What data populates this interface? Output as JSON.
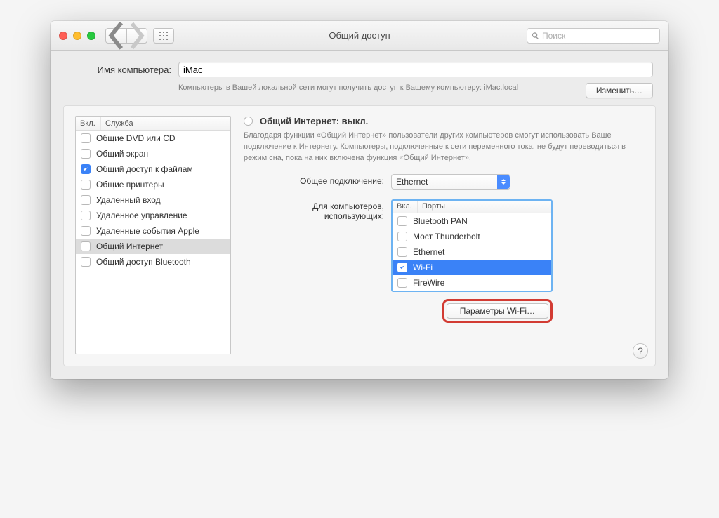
{
  "window": {
    "title": "Общий доступ",
    "search_placeholder": "Поиск"
  },
  "computer": {
    "label": "Имя компьютера:",
    "value": "iMac",
    "desc": "Компьютеры в Вашей локальной сети могут получить доступ к Вашему компьютеру: iMac.local",
    "edit_btn": "Изменить…"
  },
  "services": {
    "col_enabled": "Вкл.",
    "col_service": "Служба",
    "items": [
      {
        "label": "Общие DVD или CD",
        "checked": false
      },
      {
        "label": "Общий экран",
        "checked": false
      },
      {
        "label": "Общий доступ к файлам",
        "checked": true
      },
      {
        "label": "Общие принтеры",
        "checked": false
      },
      {
        "label": "Удаленный вход",
        "checked": false
      },
      {
        "label": "Удаленное управление",
        "checked": false
      },
      {
        "label": "Удаленные события Apple",
        "checked": false
      },
      {
        "label": "Общий Интернет",
        "checked": false,
        "selected": true
      },
      {
        "label": "Общий доступ Bluetooth",
        "checked": false
      }
    ]
  },
  "detail": {
    "status": "Общий Интернет: выкл.",
    "info": "Благодаря функции «Общий Интернет» пользователи других компьютеров смогут использовать Ваше подключение к Интернету. Компьютеры, подключенные к сети переменного тока, не будут переводиться в режим сна, пока на них включена функция «Общий Интернет».",
    "conn_label": "Общее подключение:",
    "conn_value": "Ethernet",
    "ports_label_1": "Для компьютеров,",
    "ports_label_2": "использующих:",
    "ports_col_enabled": "Вкл.",
    "ports_col_ports": "Порты",
    "ports": [
      {
        "label": "Bluetooth PAN",
        "checked": false
      },
      {
        "label": "Мост Thunderbolt",
        "checked": false
      },
      {
        "label": "Ethernet",
        "checked": false
      },
      {
        "label": "Wi-Fi",
        "checked": true,
        "selected": true
      },
      {
        "label": "FireWire",
        "checked": false
      }
    ],
    "wifi_btn": "Параметры Wi-Fi…"
  },
  "help": "?"
}
